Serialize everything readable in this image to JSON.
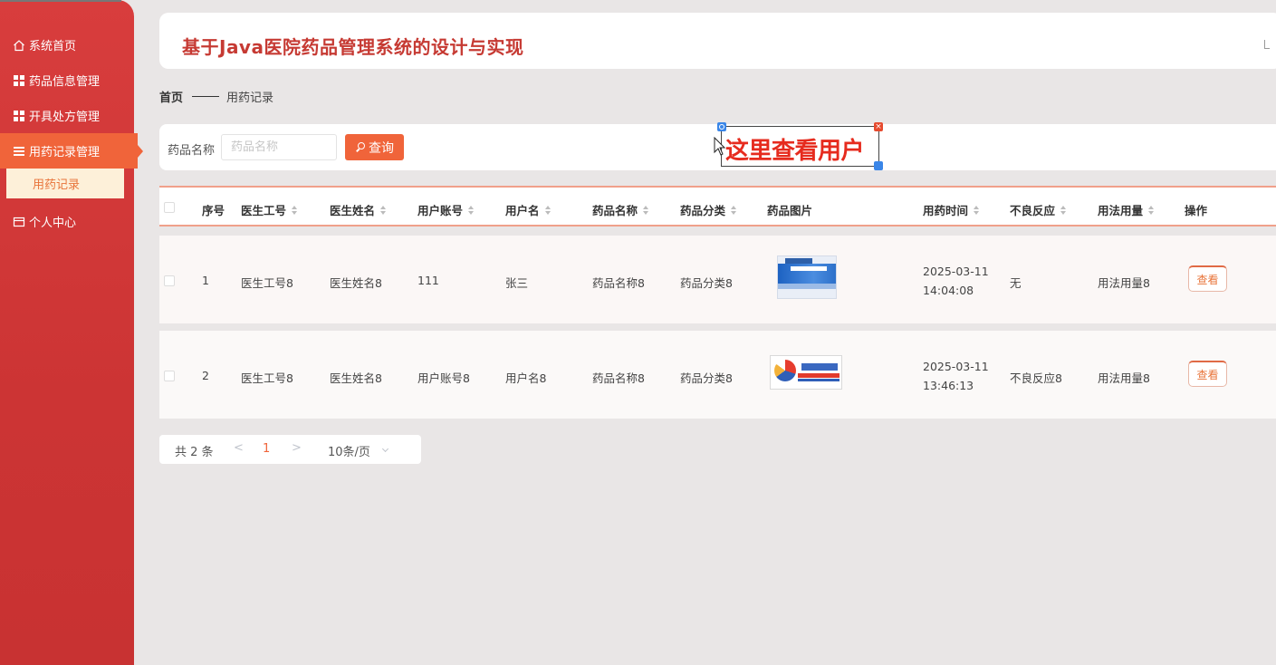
{
  "app": {
    "title": "基于Java医院药品管理系统的设计与实现"
  },
  "sidebar": {
    "items": [
      {
        "label": "系统首页",
        "icon": "home-icon"
      },
      {
        "label": "药品信息管理",
        "icon": "grid-icon"
      },
      {
        "label": "开具处方管理",
        "icon": "grid-icon"
      },
      {
        "label": "用药记录管理",
        "icon": "list-icon",
        "active": true
      },
      {
        "label": "个人中心",
        "icon": "card-icon"
      }
    ],
    "subitem": {
      "label": "用药记录"
    }
  },
  "breadcrumb": {
    "home": "首页",
    "current": "用药记录"
  },
  "search": {
    "label": "药品名称",
    "placeholder": "药品名称",
    "value": "",
    "button": "查询"
  },
  "annotation": {
    "text": "这里查看用户"
  },
  "table": {
    "headers": {
      "index": "序号",
      "doctor_id": "医生工号",
      "doctor_name": "医生姓名",
      "user_account": "用户账号",
      "username": "用户名",
      "drug_name": "药品名称",
      "drug_category": "药品分类",
      "drug_image": "药品图片",
      "time": "用药时间",
      "adverse": "不良反应",
      "usage": "用法用量",
      "actions": "操作"
    },
    "rows": [
      {
        "index": "1",
        "doctor_id": "医生工号8",
        "doctor_name": "医生姓名8",
        "user_account": "111",
        "username": "张三",
        "drug_name": "药品名称8",
        "drug_category": "药品分类8",
        "time": "2025-03-11 14:04:08",
        "adverse": "无",
        "usage": "用法用量8",
        "action": "查看"
      },
      {
        "index": "2",
        "doctor_id": "医生工号8",
        "doctor_name": "医生姓名8",
        "user_account": "用户账号8",
        "username": "用户名8",
        "drug_name": "药品名称8",
        "drug_category": "药品分类8",
        "time": "2025-03-11 13:46:13",
        "adverse": "不良反应8",
        "usage": "用法用量8",
        "action": "查看"
      }
    ]
  },
  "pagination": {
    "total": "共 2 条",
    "prev": "<",
    "page": "1",
    "next": ">",
    "page_size": "10条/页"
  },
  "colors": {
    "sidebar": "#cc3434",
    "accent": "#f0643a",
    "title": "#c63a33",
    "annotation": "#e62b1e"
  }
}
